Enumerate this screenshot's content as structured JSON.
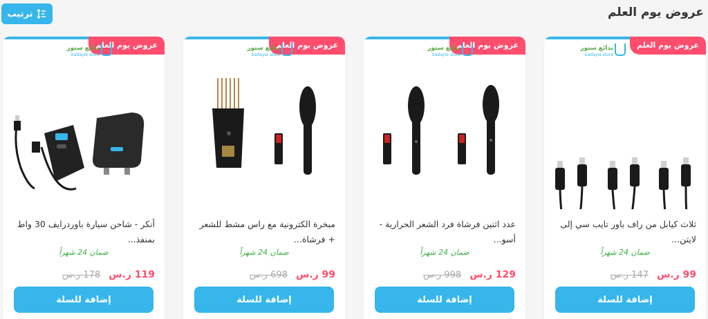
{
  "section": {
    "title": "عروض يوم العلم",
    "sort_label": "ترتيب"
  },
  "colors": {
    "accent": "#36b6ea",
    "badge": "#ff4d6d",
    "warranty": "#3cb043",
    "old_price": "#aaaaaa"
  },
  "store_logo": {
    "name": "بدائع ستور",
    "sub": "badayie store"
  },
  "products": [
    {
      "badge": "عروض يوم العلم",
      "title": "ثلاث كيابل من راف باور تايب سي إلى لايتن...",
      "warranty": "ضمان 24 شهراً",
      "price": "99 ر.س",
      "old_price": "147 ر.س",
      "add_label": "إضافة للسلة",
      "image_icon": "usb-c-lightning-cables-image"
    },
    {
      "badge": "عروض يوم العلم",
      "title": "عدد اثنين فرشاة فرد الشعر الحرارية - أسو...",
      "warranty": "ضمان 24 شهراً",
      "price": "129 ر.س",
      "old_price": "998 ر.س",
      "add_label": "إضافة للسلة",
      "image_icon": "hair-straightener-brushes-image"
    },
    {
      "badge": "عروض يوم العلم",
      "title": "مبخرة الكترونية مع راس مشط للشعر + فرشاة...",
      "warranty": "ضمان 24 شهراً",
      "price": "99 ر.س",
      "old_price": "698 ر.س",
      "add_label": "إضافة للسلة",
      "image_icon": "incense-burner-comb-brush-image"
    },
    {
      "badge": "عروض يوم العلم",
      "title": "أنكر - شاحن سيارة باوردرايف 30 واط بمنفذ...",
      "warranty": "ضمان 24 شهراً",
      "price": "119 ر.س",
      "old_price": "178 ر.س",
      "add_label": "إضافة للسلة",
      "image_icon": "anker-car-charger-image"
    }
  ]
}
